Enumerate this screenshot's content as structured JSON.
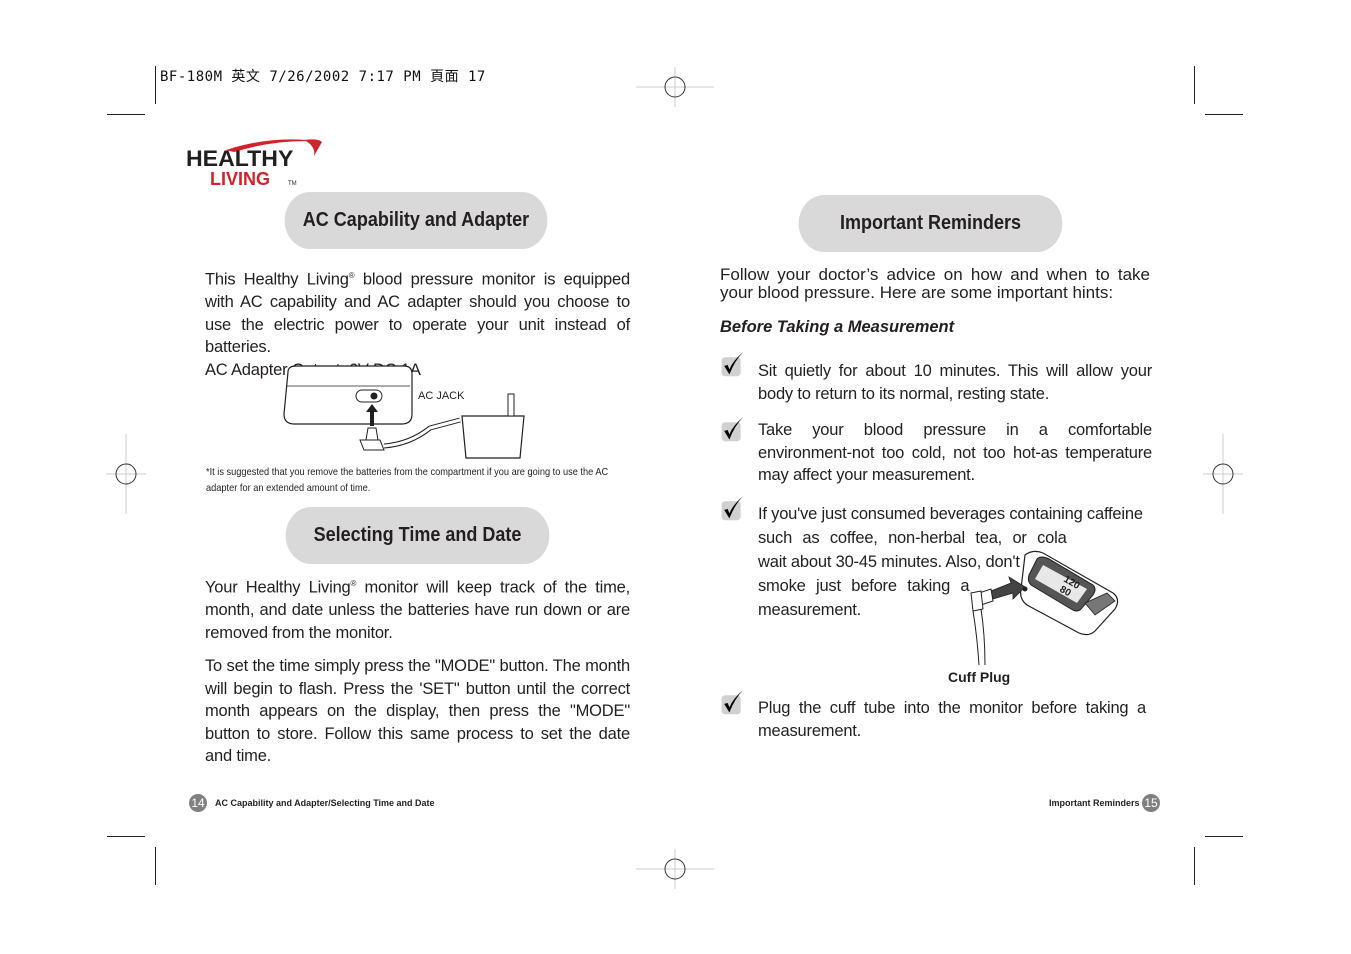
{
  "print_header": "BF-180M 英文  7/26/2002  7:17 PM  頁面 17",
  "logo": {
    "line1": "HEALTHY",
    "line2": "LIVING",
    "tm": "TM",
    "arc_color": "#d2232a",
    "text_color": "#231f20",
    "accent_color": "#d2232a"
  },
  "left_page": {
    "heading1": "AC Capability and  Adapter",
    "intro_part1": "This Healthy Living",
    "registered": "®",
    "intro_part2": " blood pressure monitor is equipped with AC capability and AC adapter should you choose to use the electric power to operate your unit instead of batteries.",
    "adapter_output": "AC Adapter Output: 6V DC 1A",
    "figure_label": "AC JACK",
    "footnote": "*It is suggested that you remove the batteries from the compartment if you are going to use the AC adapter for an extended amount of time.",
    "heading2": "Selecting  Time and Date",
    "time_para1_part1": "Your Healthy Living",
    "time_para1_part2": "  monitor will keep track of the time, month, and date unless the batteries have run down or are removed from the monitor.",
    "time_para2": "To set the time simply press the \"MODE\" button. The month will begin to flash. Press the 'SET\" button until the correct month appears on the display, then press the \"MODE\" button to store. Follow this same process to set the date and time.",
    "footer": {
      "page_number": "14",
      "label": "AC Capability and Adapter/Selecting Time and Date"
    }
  },
  "right_page": {
    "heading": "Important Reminders",
    "intro": "Follow  your doctor’s advice on how and when to take your blood pressure. Here are some important hints:",
    "subheading": "Before Taking a Measurement",
    "items": [
      {
        "text": "Sit quietly for about 10 minutes. This will allow your body to return to its normal, resting state."
      },
      {
        "text": "Take your blood pressure in a comfortable environment-not too cold, not too hot-as temperature may affect your measurement."
      },
      {
        "lines": [
          "If you've just consumed beverages containing caffeine",
          "such as coffee, non-herbal tea, or cola",
          "wait about 30-45 minutes. Also, don't",
          "smoke just before taking a",
          "measurement."
        ]
      },
      {
        "text": "Plug the cuff tube into the monitor before taking a measurement."
      }
    ],
    "figure_label": "Cuff Plug",
    "display_values": {
      "systolic": "120",
      "diastolic": "80"
    },
    "footer": {
      "page_number": "15",
      "label": "Important Reminders"
    }
  }
}
